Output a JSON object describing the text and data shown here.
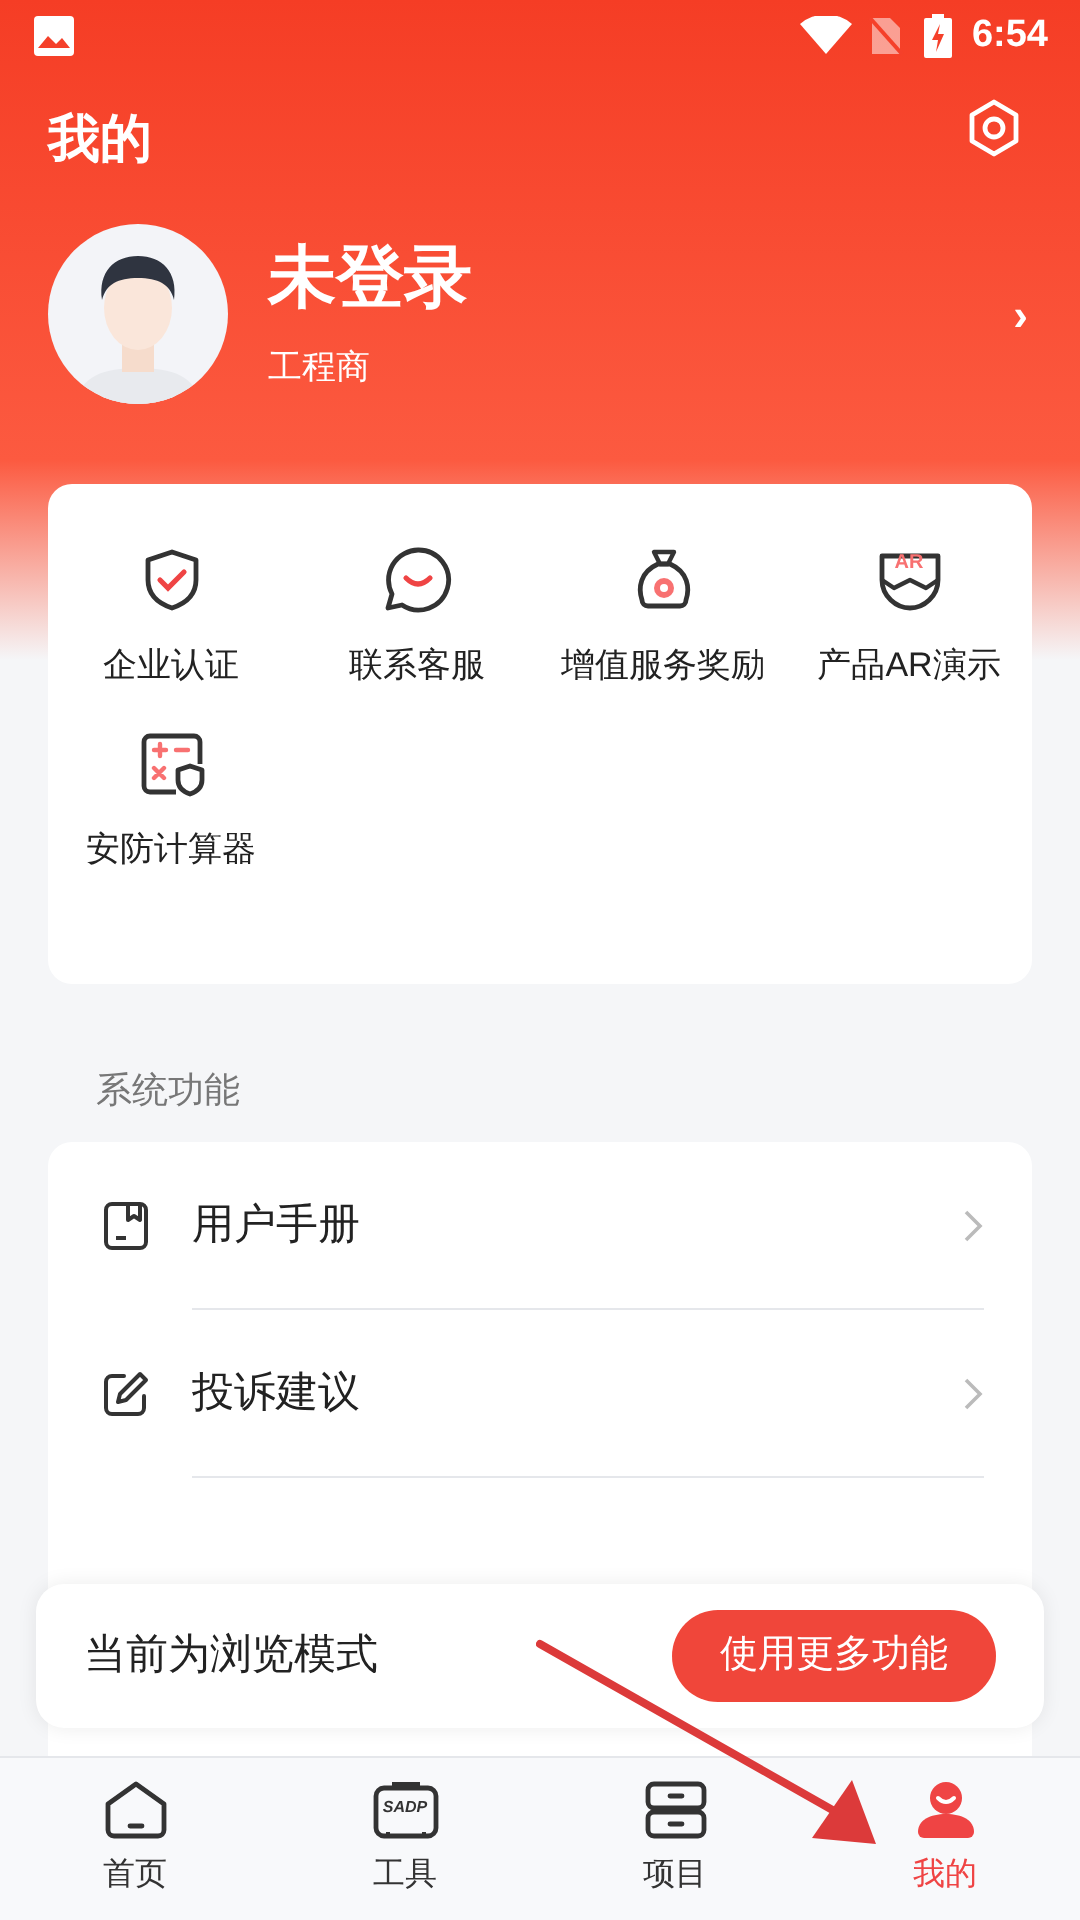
{
  "status_bar": {
    "time": "6:54"
  },
  "header": {
    "title": "我的"
  },
  "profile": {
    "name": "未登录",
    "role": "工程商",
    "chevron": "›"
  },
  "shortcuts": [
    {
      "kind": "shield",
      "label": "企业认证"
    },
    {
      "kind": "chat",
      "label": "联系客服"
    },
    {
      "kind": "moneybag",
      "label": "增值服务奖励"
    },
    {
      "kind": "ar",
      "label": "产品AR演示",
      "icon_text": "AR"
    },
    {
      "kind": "calculator",
      "label": "安防计算器"
    }
  ],
  "system_section": {
    "title": "系统功能",
    "items": [
      {
        "kind": "manual",
        "label": "用户手册"
      },
      {
        "kind": "edit",
        "label": "投诉建议"
      }
    ]
  },
  "browse_banner": {
    "text": "当前为浏览模式",
    "button": "使用更多功能"
  },
  "bottom_nav": [
    {
      "kind": "home",
      "label": "首页",
      "selected": false
    },
    {
      "kind": "tools",
      "label": "工具",
      "icon_text": "SADP",
      "selected": false
    },
    {
      "kind": "project",
      "label": "项目",
      "selected": false
    },
    {
      "kind": "me",
      "label": "我的",
      "selected": true
    }
  ]
}
